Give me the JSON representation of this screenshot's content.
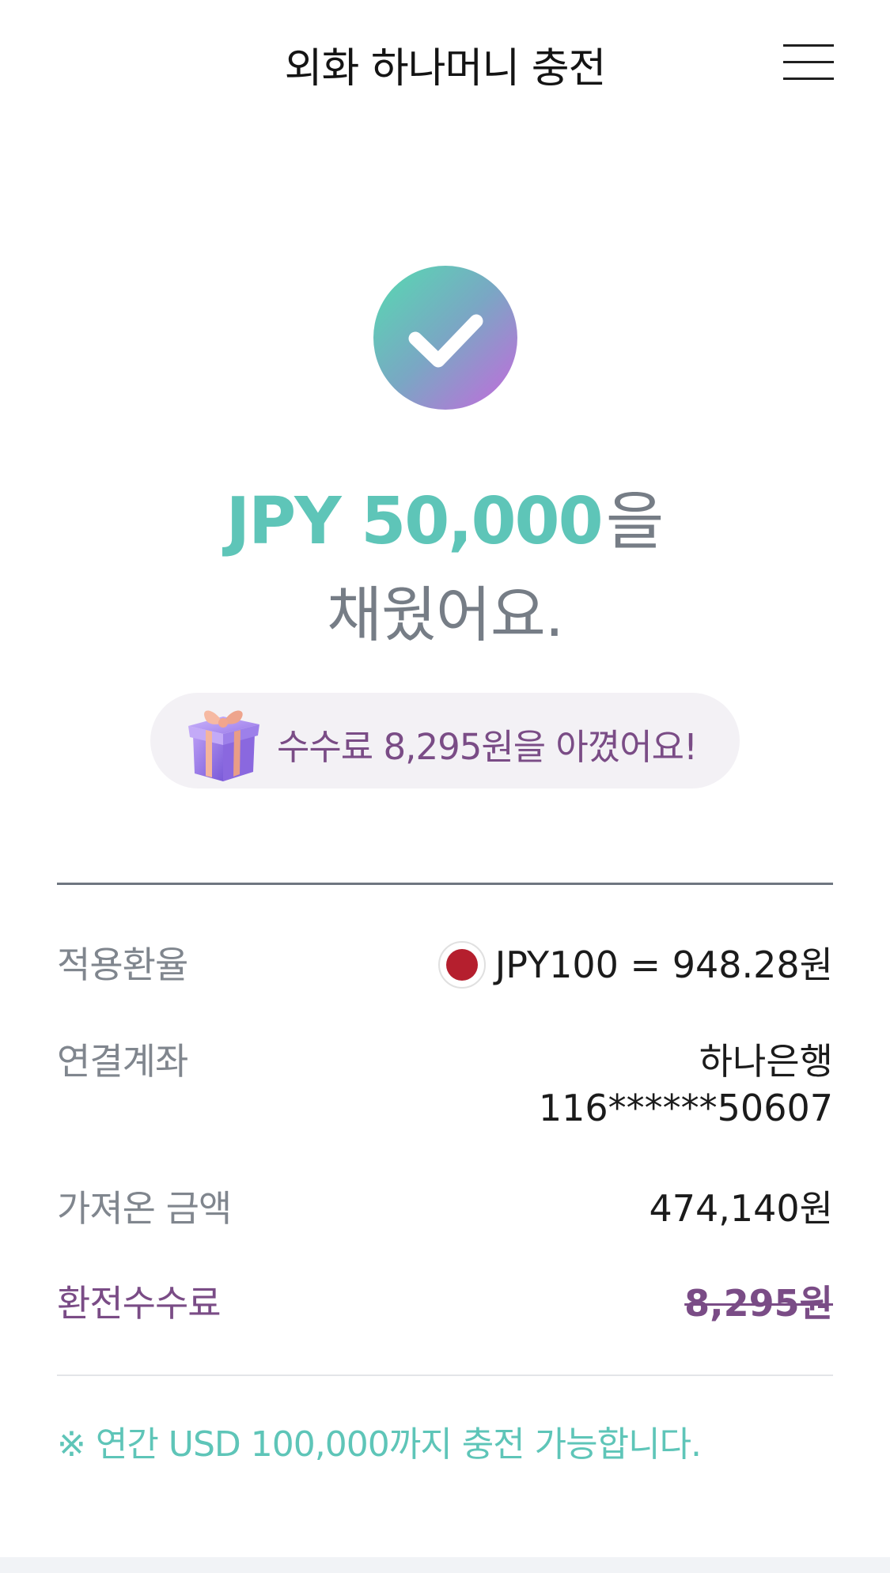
{
  "header": {
    "title": "외화 하나머니 충전",
    "menu_icon": "hamburger-menu-icon"
  },
  "success": {
    "icon": "check-icon",
    "amount": "JPY 50,000",
    "particle": "을",
    "line2": "채웠어요."
  },
  "savings": {
    "icon": "gift-icon",
    "text": "수수료 8,295원을 아꼈어요!"
  },
  "details": {
    "exchange_rate": {
      "label": "적용환율",
      "flag": "japan-flag-icon",
      "value": "JPY100 = 948.28원"
    },
    "linked_account": {
      "label": "연결계좌",
      "bank": "하나은행",
      "number": "116******50607"
    },
    "amount_taken": {
      "label": "가져온 금액",
      "value": "474,140원"
    },
    "exchange_fee": {
      "label": "환전수수료",
      "value": "8,295원"
    }
  },
  "notice": "※ 연간 USD 100,000까지 충전 가능합니다.",
  "colors": {
    "accent_teal": "#5ec5b8",
    "accent_purple": "#7a4c86",
    "muted_text": "#767d86"
  }
}
